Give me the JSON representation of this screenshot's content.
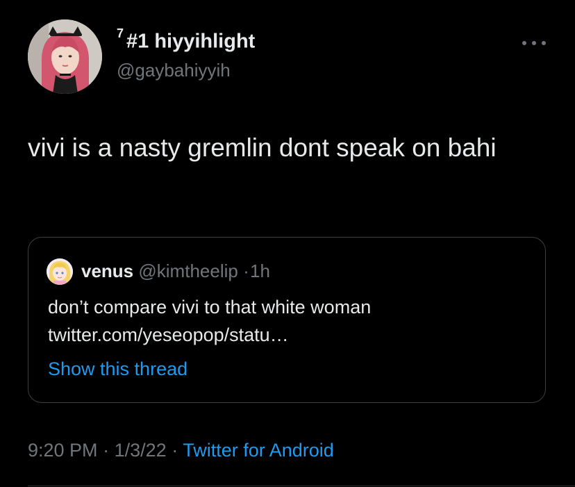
{
  "author": {
    "rank_superscript": "7",
    "display_name": "#1 hiyyihlight",
    "handle": "@gaybahiyyih",
    "avatar_icon": "profile-photo"
  },
  "more_icon": "ellipsis-icon",
  "tweet_text": "vivi is a nasty gremlin dont speak on bahi",
  "quote": {
    "name": "venus",
    "handle": "@kimtheelip",
    "separator": "·",
    "time": "1h",
    "text_line1": "don’t compare vivi to that white woman",
    "text_line2": "twitter.com/yeseopop/statu…",
    "show_thread": "Show this thread",
    "avatar_icon": "cartoon-avatar"
  },
  "footer": {
    "time": "9:20 PM",
    "sep1": "·",
    "date": "1/3/22",
    "sep2": "·",
    "source": "Twitter for Android"
  },
  "colors": {
    "background": "#000000",
    "primary_text": "#e7e9ea",
    "secondary_text": "#71767b",
    "link": "#1d9bf0",
    "border": "#3b3f44"
  }
}
